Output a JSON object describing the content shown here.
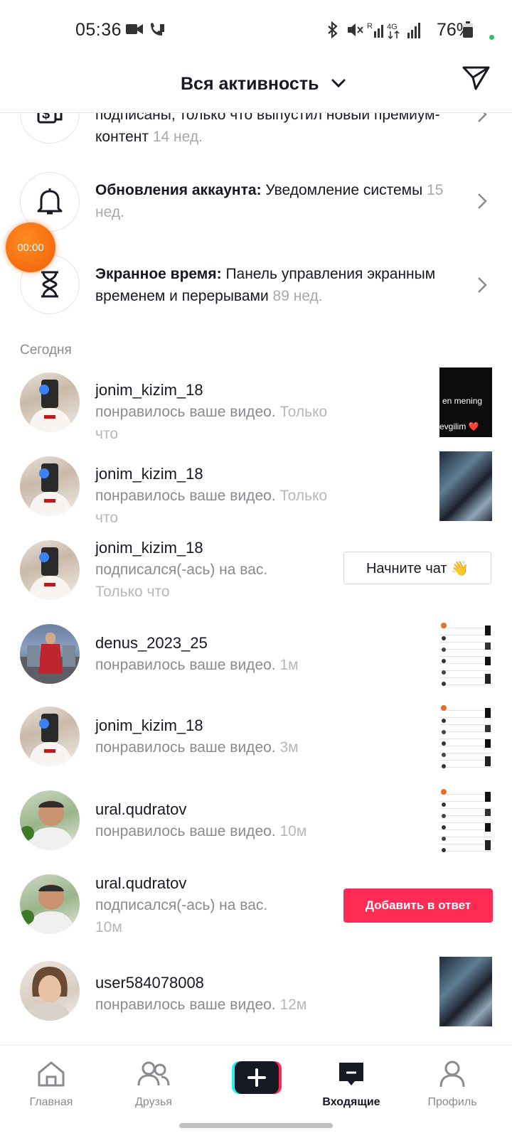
{
  "status_bar": {
    "time": "05:36",
    "battery": "76%",
    "icons": [
      "video-camera-icon",
      "call-icon",
      "bluetooth-icon",
      "mute-icon",
      "signal-icon",
      "4g-icon",
      "battery-icon"
    ]
  },
  "header": {
    "title": "Вся активность",
    "dropdown_icon": "chevron-down-icon",
    "action_icon": "send-icon"
  },
  "system_items": [
    {
      "icon": "premium-icon",
      "bold": "",
      "text": "подписаны, только что выпустил новый премиум-контент",
      "time": "14 нед."
    },
    {
      "icon": "bell-icon",
      "bold": "Обновления аккаунта:",
      "text": "Уведомление системы",
      "time": "15 нед."
    },
    {
      "icon": "hourglass-icon",
      "bold": "Экранное время:",
      "text": "Панель управления экранным временем и перерывами",
      "time": "89 нед."
    }
  ],
  "timer": "00:00",
  "section_today": "Сегодня",
  "activities": [
    {
      "user": "jonim_kizim_18",
      "action": "понравилось ваше видео.",
      "time": "Только что",
      "thumb_text_1": "en mening",
      "thumb_text_2": "evgilim ❤️"
    },
    {
      "user": "jonim_kizim_18",
      "action": "понравилось ваше видео.",
      "time": "Только что"
    },
    {
      "user": "jonim_kizim_18",
      "action": "подписался(-ась) на вас.",
      "time": "Только что",
      "button": "Начните чат 👋"
    },
    {
      "user": "denus_2023_25",
      "action": "понравилось ваше видео.",
      "time": "1м"
    },
    {
      "user": "jonim_kizim_18",
      "action": "понравилось ваше видео.",
      "time": "3м"
    },
    {
      "user": "ural.qudratov",
      "action": "понравилось ваше видео.",
      "time": "10м"
    },
    {
      "user": "ural.qudratov",
      "action": "подписался(-ась) на вас.",
      "time": "10м",
      "button": "Добавить в ответ"
    },
    {
      "user": "user584078008",
      "action": "понравилось ваше видео.",
      "time": "12м"
    }
  ],
  "nav": {
    "home": "Главная",
    "friends": "Друзья",
    "inbox": "Входящие",
    "profile": "Профиль"
  },
  "colors": {
    "accent": "#fe2c55",
    "timer": "#f0600a",
    "text": "#161823",
    "muted": "#8a8b91"
  }
}
